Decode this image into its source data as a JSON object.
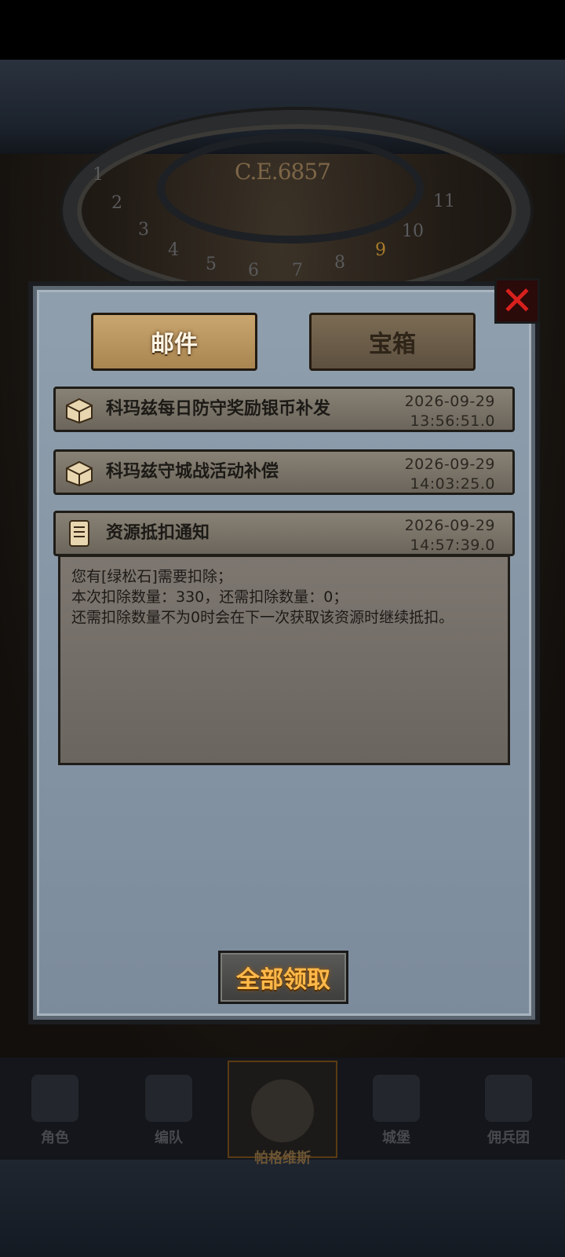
{
  "background": {
    "era": "C.E.6857",
    "dial_numbers": [
      "1",
      "2",
      "3",
      "4",
      "5",
      "6",
      "7",
      "8",
      "9",
      "10",
      "11"
    ]
  },
  "mail_window": {
    "tabs": [
      {
        "label": "邮件",
        "active": true
      },
      {
        "label": "宝箱",
        "active": false
      }
    ],
    "close_icon": "close-x-icon",
    "mails": [
      {
        "icon": "chest-icon",
        "subject": "科玛兹每日防守奖励银币补发",
        "date": "2026-09-29",
        "time": "13:56:51.0"
      },
      {
        "icon": "chest-icon",
        "subject": "科玛兹守城战活动补偿",
        "date": "2026-09-29",
        "time": "14:03:25.0"
      },
      {
        "icon": "scroll-icon",
        "subject": "资源抵扣通知",
        "date": "2026-09-29",
        "time": "14:57:39.0"
      }
    ],
    "body_lines": [
      "您有[绿松石]需要扣除；",
      "本次扣除数量：330，还需扣除数量：0；",
      "还需扣除数量不为0时会在下一次获取该资源时继续抵扣。"
    ],
    "claim_all_label": "全部领取"
  },
  "bottom_nav": [
    {
      "label": "角色",
      "icon": "knight-icon",
      "active": false
    },
    {
      "label": "编队",
      "icon": "helmet-icon",
      "active": false
    },
    {
      "label": "帕格维斯",
      "icon": "compass-icon",
      "active": true
    },
    {
      "label": "城堡",
      "icon": "castle-icon",
      "active": false
    },
    {
      "label": "佣兵团",
      "icon": "flag-icon",
      "active": false
    }
  ],
  "colors": {
    "panel": "#8595a5",
    "tab_active": "#c9a56f",
    "close_red": "#d8201d",
    "claim_text": "#ffb94a"
  }
}
